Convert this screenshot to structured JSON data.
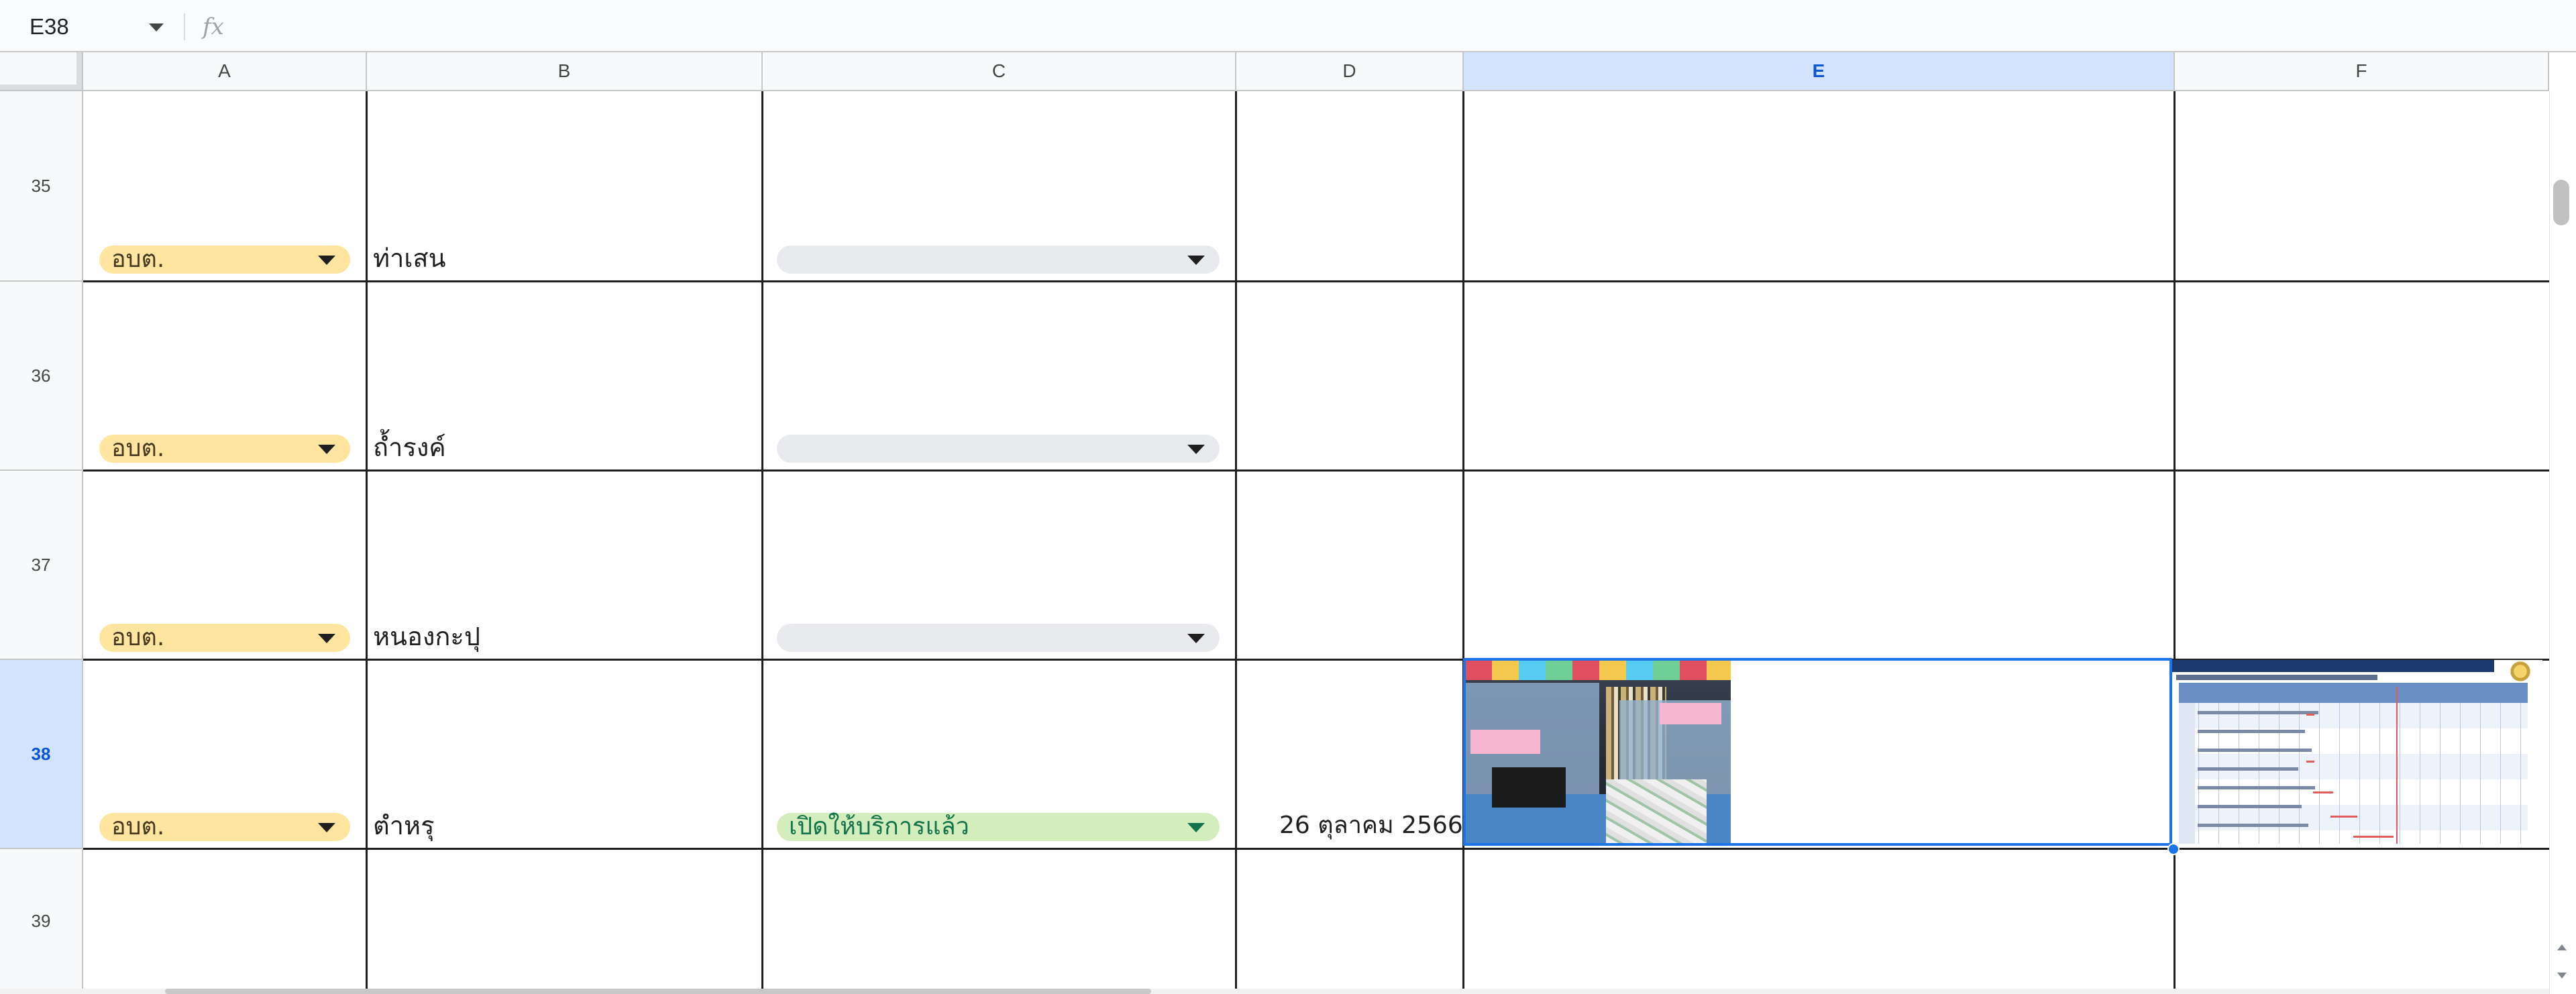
{
  "formula_bar": {
    "name_box": "E38",
    "fx_label": "fx",
    "formula": ""
  },
  "columns": [
    {
      "id": "A",
      "label": "A"
    },
    {
      "id": "B",
      "label": "B"
    },
    {
      "id": "C",
      "label": "C"
    },
    {
      "id": "D",
      "label": "D"
    },
    {
      "id": "E",
      "label": "E",
      "selected": true
    },
    {
      "id": "F",
      "label": "F"
    }
  ],
  "rows": [
    {
      "number": "35",
      "type": "อบต.",
      "name": "ท่าเสน",
      "status": "",
      "date": ""
    },
    {
      "number": "36",
      "type": "อบต.",
      "name": "ถ้ำรงค์",
      "status": "",
      "date": ""
    },
    {
      "number": "37",
      "type": "อบต.",
      "name": "หนองกะปุ",
      "status": "",
      "date": ""
    },
    {
      "number": "38",
      "type": "อบต.",
      "name": "ตำหรุ",
      "status": "เปิดให้บริการแล้ว",
      "date": "26 ตุลาคม 2566",
      "selected": true
    },
    {
      "number": "39",
      "type": "",
      "name": "",
      "status": "",
      "date": ""
    }
  ],
  "colors": {
    "type_chip": "#ffe5a0",
    "empty_chip": "#e8eaed",
    "status_open_chip": "#d4edbc",
    "status_open_text": "#11734b",
    "selection": "#1a73e8",
    "header_selected": "#d3e3fd"
  },
  "images": {
    "E38": "service-counter-photo",
    "F38": "schedule-document-thumbnail"
  },
  "selected_cell": "E38"
}
